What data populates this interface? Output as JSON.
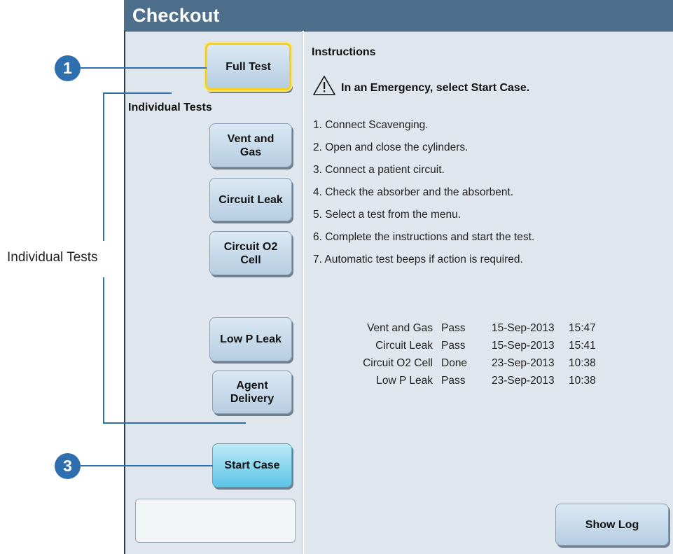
{
  "window": {
    "title": "Checkout"
  },
  "left_panel": {
    "full_test_label": "Full Test",
    "section_label": "Individual Tests",
    "tests": [
      {
        "label": "Vent and\nGas"
      },
      {
        "label": "Circuit Leak"
      },
      {
        "label": "Circuit O2\nCell"
      },
      {
        "label": "Low P Leak"
      },
      {
        "label": "Agent\nDelivery"
      }
    ],
    "start_case_label": "Start Case"
  },
  "instructions": {
    "heading": "Instructions",
    "warning": "In an Emergency, select Start Case.",
    "steps": [
      "1.  Connect Scavenging.",
      "2.  Open and close the cylinders.",
      "3.  Connect a patient circuit.",
      "4.  Check the absorber and the absorbent.",
      "5.  Select a test from the menu.",
      "6.  Complete the instructions and start the test.",
      "7.  Automatic test beeps if action is required."
    ]
  },
  "log": {
    "rows": [
      {
        "test": "Vent and Gas",
        "result": "Pass",
        "date": "15-Sep-2013",
        "time": "15:47"
      },
      {
        "test": "Circuit Leak",
        "result": "Pass",
        "date": "15-Sep-2013",
        "time": "15:41"
      },
      {
        "test": "Circuit O2 Cell",
        "result": "Done",
        "date": "23-Sep-2013",
        "time": "10:38"
      },
      {
        "test": "Low P Leak",
        "result": "Pass",
        "date": "23-Sep-2013",
        "time": "10:38"
      }
    ],
    "show_log_label": "Show Log"
  },
  "callouts": {
    "badge_1": "1",
    "badge_3": "3",
    "bracket_label": "Individual Tests"
  },
  "colors": {
    "title_bar": "#4d6f8c",
    "callout": "#2f6fb0",
    "selection": "#f5d11d",
    "primary_button": "#5cc4e6"
  }
}
